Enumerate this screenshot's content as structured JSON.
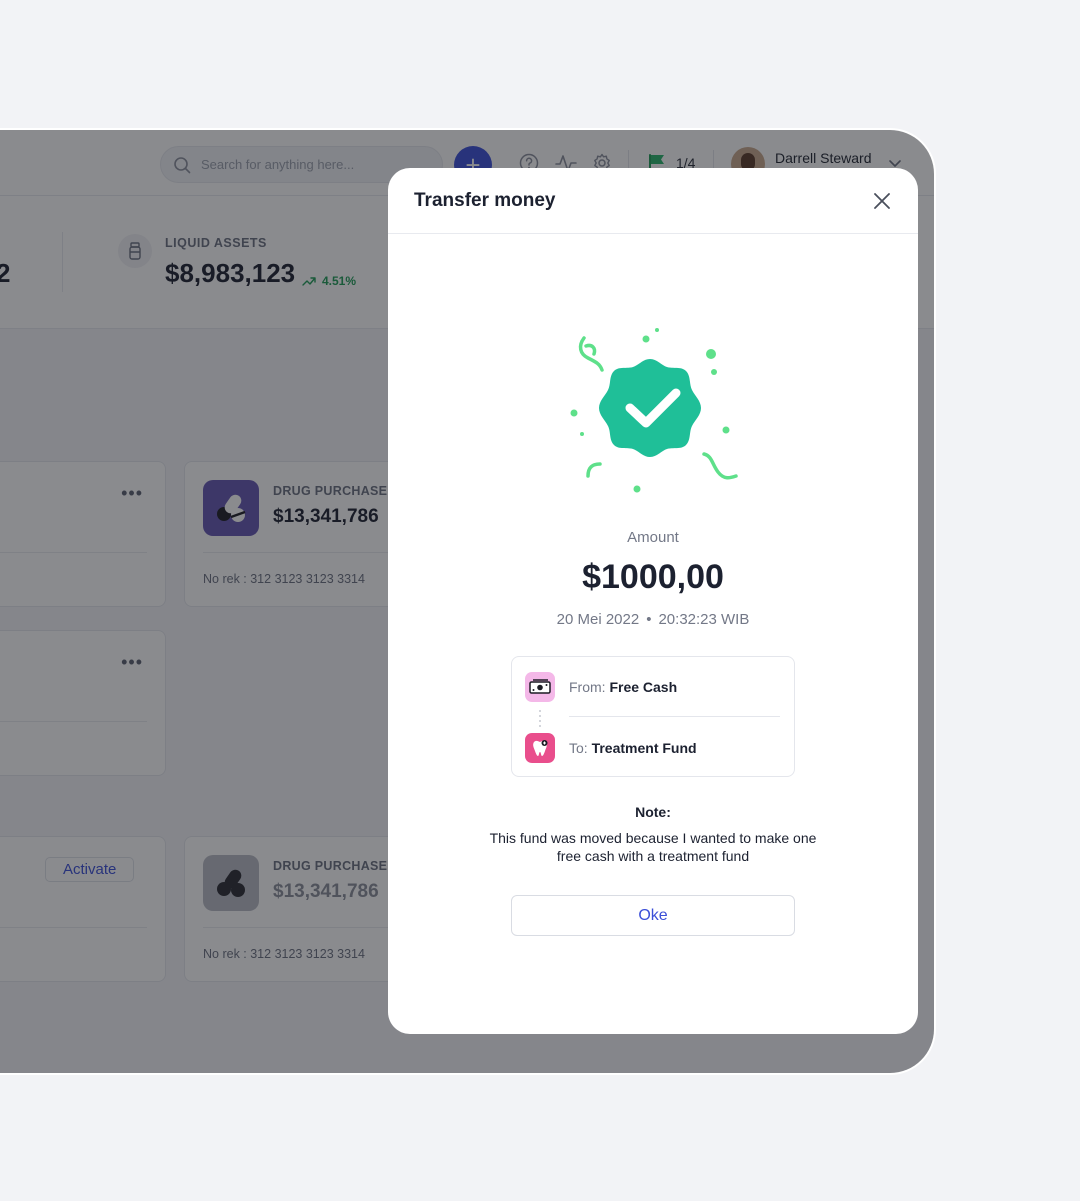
{
  "topbar": {
    "search_placeholder": "Search for anything here...",
    "add_label": "+",
    "flag_count": "1/4",
    "user_name": "Darrell Steward"
  },
  "stats": {
    "partial_value": "2",
    "liquid_label": "LIQUID ASSETS",
    "liquid_value": "$8,983,123",
    "liquid_trend": "4.51%"
  },
  "cards": {
    "dots": "•••",
    "drug_title": "DRUG PURCHASE",
    "drug_amount": "$13,341,786",
    "drug_rek": "No rek : 312 3123 3123 3314",
    "activate_label": "Activate"
  },
  "modal": {
    "title": "Transfer money",
    "amount_label": "Amount",
    "amount_value": "$1000,00",
    "date": "20 Mei 2022",
    "time": "20:32:23 WIB",
    "from_label": "From:",
    "from_value": "Free Cash",
    "to_label": "To:",
    "to_value": "Treatment Fund",
    "note_title": "Note:",
    "note_text": "This fund was moved because I wanted to make one free cash with a treatment fund",
    "ok_label": "Oke"
  },
  "colors": {
    "accent": "#3b4fd8",
    "success": "#1fbf98",
    "confetti": "#5ee08a",
    "trend_up": "#1f9d57"
  }
}
